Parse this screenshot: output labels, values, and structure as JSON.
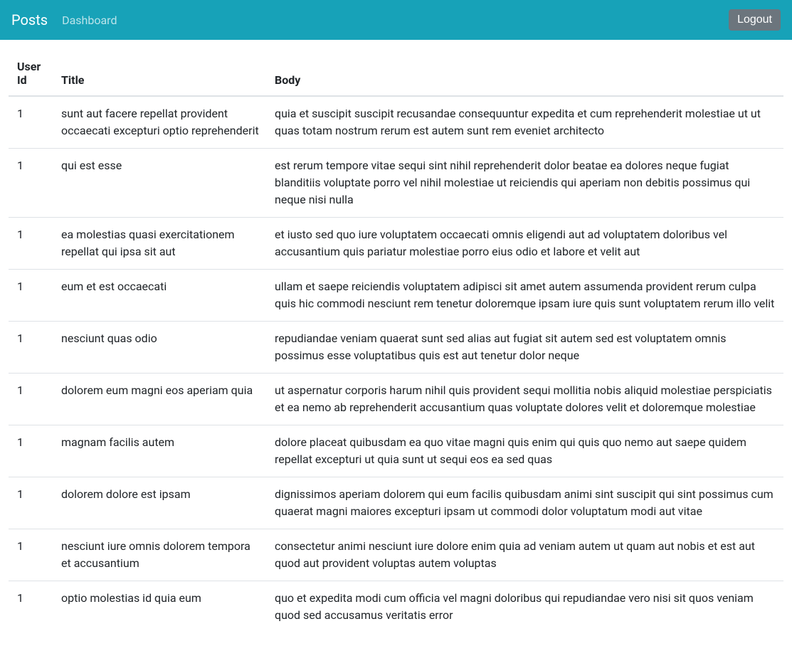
{
  "navbar": {
    "brand": "Posts",
    "dashboard": "Dashboard",
    "logout": "Logout"
  },
  "table": {
    "headers": {
      "userId": "User Id",
      "title": "Title",
      "body": "Body"
    },
    "rows": [
      {
        "userId": "1",
        "title": "sunt aut facere repellat provident occaecati excepturi optio reprehenderit",
        "body": "quia et suscipit suscipit recusandae consequuntur expedita et cum reprehenderit molestiae ut ut quas totam nostrum rerum est autem sunt rem eveniet architecto"
      },
      {
        "userId": "1",
        "title": "qui est esse",
        "body": "est rerum tempore vitae sequi sint nihil reprehenderit dolor beatae ea dolores neque fugiat blanditiis voluptate porro vel nihil molestiae ut reiciendis qui aperiam non debitis possimus qui neque nisi nulla"
      },
      {
        "userId": "1",
        "title": "ea molestias quasi exercitationem repellat qui ipsa sit aut",
        "body": "et iusto sed quo iure voluptatem occaecati omnis eligendi aut ad voluptatem doloribus vel accusantium quis pariatur molestiae porro eius odio et labore et velit aut"
      },
      {
        "userId": "1",
        "title": "eum et est occaecati",
        "body": "ullam et saepe reiciendis voluptatem adipisci sit amet autem assumenda provident rerum culpa quis hic commodi nesciunt rem tenetur doloremque ipsam iure quis sunt voluptatem rerum illo velit"
      },
      {
        "userId": "1",
        "title": "nesciunt quas odio",
        "body": "repudiandae veniam quaerat sunt sed alias aut fugiat sit autem sed est voluptatem omnis possimus esse voluptatibus quis est aut tenetur dolor neque"
      },
      {
        "userId": "1",
        "title": "dolorem eum magni eos aperiam quia",
        "body": "ut aspernatur corporis harum nihil quis provident sequi mollitia nobis aliquid molestiae perspiciatis et ea nemo ab reprehenderit accusantium quas voluptate dolores velit et doloremque molestiae"
      },
      {
        "userId": "1",
        "title": "magnam facilis autem",
        "body": "dolore placeat quibusdam ea quo vitae magni quis enim qui quis quo nemo aut saepe quidem repellat excepturi ut quia sunt ut sequi eos ea sed quas"
      },
      {
        "userId": "1",
        "title": "dolorem dolore est ipsam",
        "body": "dignissimos aperiam dolorem qui eum facilis quibusdam animi sint suscipit qui sint possimus cum quaerat magni maiores excepturi ipsam ut commodi dolor voluptatum modi aut vitae"
      },
      {
        "userId": "1",
        "title": "nesciunt iure omnis dolorem tempora et accusantium",
        "body": "consectetur animi nesciunt iure dolore enim quia ad veniam autem ut quam aut nobis et est aut quod aut provident voluptas autem voluptas"
      },
      {
        "userId": "1",
        "title": "optio molestias id quia eum",
        "body": "quo et expedita modi cum officia vel magni doloribus qui repudiandae vero nisi sit quos veniam quod sed accusamus veritatis error"
      }
    ]
  }
}
